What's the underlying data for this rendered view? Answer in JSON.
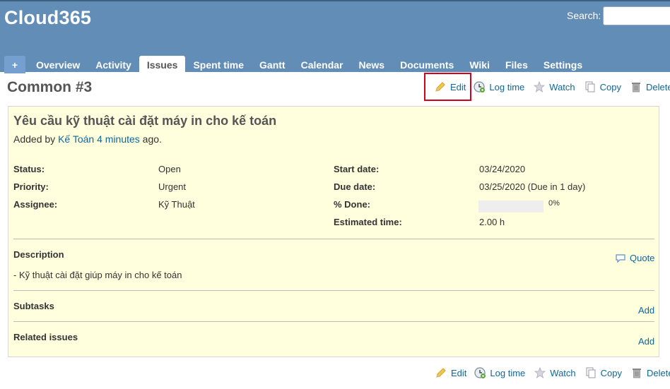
{
  "app": {
    "title": "Cloud365"
  },
  "search": {
    "label": "Search:",
    "placeholder": ""
  },
  "menu": {
    "plus": "+",
    "tabs": [
      "Overview",
      "Activity",
      "Issues",
      "Spent time",
      "Gantt",
      "Calendar",
      "News",
      "Documents",
      "Wiki",
      "Files",
      "Settings"
    ],
    "selected": "Issues"
  },
  "issue": {
    "heading": "Common #3",
    "subject": "Yêu cầu kỹ thuật cài đặt máy in cho kế toán",
    "added_by_prefix": "Added by",
    "author": "Kế Toán",
    "time_ago": "4 minutes",
    "ago_suffix": "ago.",
    "attributes": {
      "status_label": "Status:",
      "status": "Open",
      "priority_label": "Priority:",
      "priority": "Urgent",
      "assignee_label": "Assignee:",
      "assignee": "Kỹ Thuật",
      "start_label": "Start date:",
      "start": "03/24/2020",
      "due_label": "Due date:",
      "due": "03/25/2020 (Due in 1 day)",
      "done_label": "% Done:",
      "done": "0%",
      "done_fraction": 0,
      "estimated_label": "Estimated time:",
      "estimated": "2.00 h"
    },
    "description": {
      "title": "Description",
      "quote": "Quote",
      "text": "- Kỹ thuật cài đặt giúp máy in cho kế toán"
    },
    "subtasks": {
      "title": "Subtasks",
      "add": "Add"
    },
    "related": {
      "title": "Related issues",
      "add": "Add"
    }
  },
  "actions": {
    "edit": "Edit",
    "log_time": "Log time",
    "watch": "Watch",
    "copy": "Copy",
    "delete": "Delete"
  },
  "icons": [
    "pencil-icon",
    "clock-icon",
    "star-icon",
    "copy-icon",
    "trash-icon",
    "comment-icon"
  ],
  "colors": {
    "header": "#628db6",
    "link": "#116699",
    "issue_bg": "#ffffdd",
    "highlight": "#d0021b"
  }
}
